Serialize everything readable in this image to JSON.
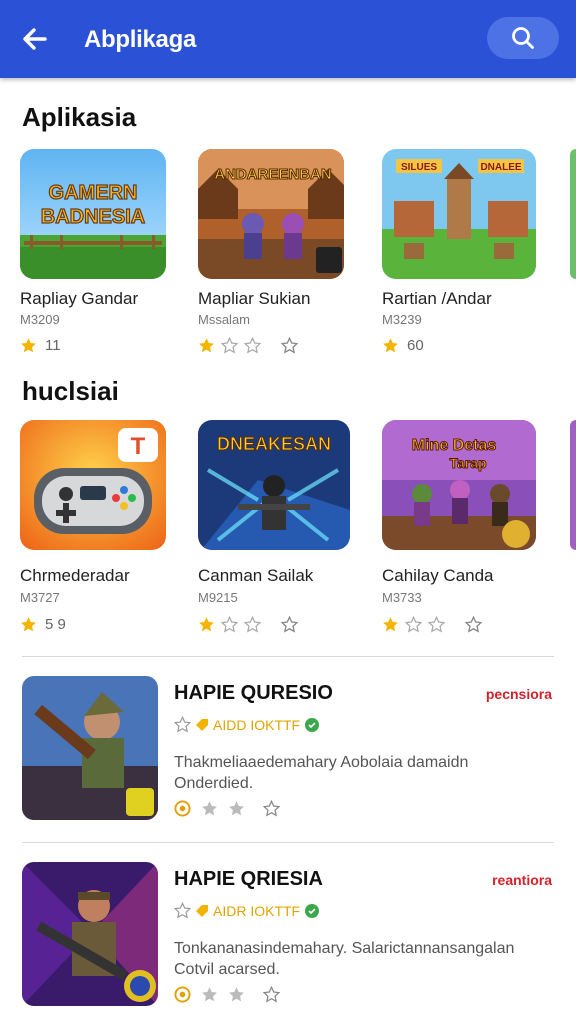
{
  "appbar": {
    "title": "Abplikaga",
    "back_icon": "arrow-left-icon",
    "search_icon": "search-icon"
  },
  "sections": [
    {
      "title": "Aplikasia",
      "cards": [
        {
          "name": "Rapliay Gandar",
          "sub": "M3209",
          "rating_text": "11",
          "art_text_1": "GAMERN",
          "art_text_2": "BADNESIA"
        },
        {
          "name": "Mapliar Sukian",
          "sub": "Mssalam",
          "rating_text": "",
          "art_text_1": "ANDAREENBAN"
        },
        {
          "name": "Rartian /Andar",
          "sub": "M3239",
          "rating_text": "60",
          "art_text_1": "SILUES",
          "art_text_2": "DNALEE"
        }
      ]
    },
    {
      "title": "huclsiai",
      "cards": [
        {
          "name": "Chrmederadar",
          "sub": "M3727",
          "rating_text": "5 9"
        },
        {
          "name": "Canman Sailak",
          "sub": "M9215",
          "rating_text": "",
          "art_text_1": "DNEAKESAN"
        },
        {
          "name": "Cahilay Canda",
          "sub": "M3733",
          "rating_text": "",
          "art_text_1": "Mine Detas",
          "art_text_2": "Tarap"
        }
      ]
    }
  ],
  "featured": [
    {
      "title": "HAPIE QURESIO",
      "badge": "pecnsiora",
      "tag": "AIDD IOKTTF",
      "description": "Thakmeliaaedemahary Aobolaia damaidn Onderdied."
    },
    {
      "title": "HAPIE QRIESIA",
      "badge": "reantiora",
      "tag": "AIDR IOKTTF",
      "description": "Tonkananasindemahary. Salarictannansangalan Cotvil acarsed."
    }
  ],
  "colors": {
    "appbar": "#2b52d6",
    "star": "#f5b400",
    "badge": "#d2232a"
  }
}
